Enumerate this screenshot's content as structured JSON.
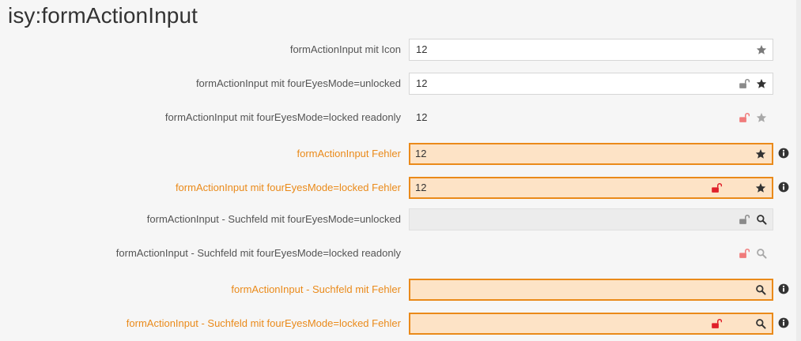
{
  "page": {
    "title": "isy:formActionInput"
  },
  "rows": [
    {
      "label": "formActionInput mit Icon",
      "value": "12"
    },
    {
      "label": "formActionInput mit fourEyesMode=unlocked",
      "value": "12"
    },
    {
      "label": "formActionInput mit fourEyesMode=locked readonly",
      "value": "12"
    },
    {
      "label": "formActionInput Fehler",
      "value": "12"
    },
    {
      "label": "formActionInput mit fourEyesMode=locked Fehler",
      "value": "12"
    },
    {
      "label": "formActionInput - Suchfeld mit fourEyesMode=unlocked",
      "value": ""
    },
    {
      "label": "formActionInput - Suchfeld mit fourEyesMode=locked readonly",
      "value": ""
    },
    {
      "label": "formActionInput - Suchfeld mit Fehler",
      "value": ""
    },
    {
      "label": "formActionInput - Suchfeld mit fourEyesMode=locked Fehler",
      "value": ""
    }
  ],
  "icons": {
    "star": "star-icon",
    "search": "search-icon",
    "unlock": "unlock-icon",
    "info": "info-icon"
  },
  "colors": {
    "error_accent": "#ea8a1a",
    "error_background": "#fde3c6",
    "lock_red": "#e0202a",
    "lock_pale_red": "#f07b7b"
  }
}
